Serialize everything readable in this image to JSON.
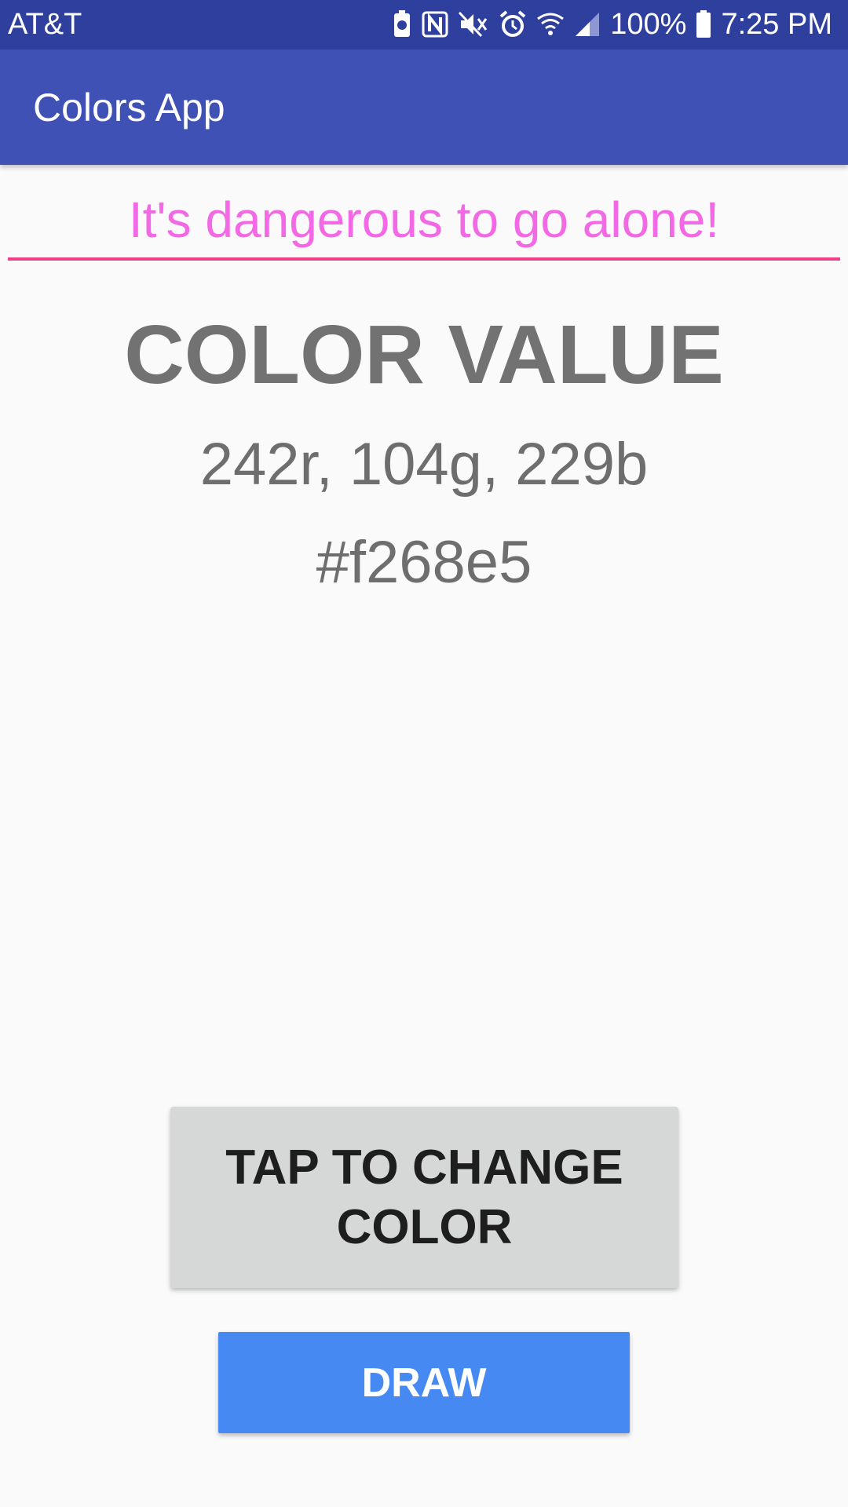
{
  "status_bar": {
    "carrier": "AT&T",
    "battery_percent": "100%",
    "time": "7:25 PM",
    "icons": [
      "battery-saver-icon",
      "nfc-icon",
      "mute-icon",
      "alarm-icon",
      "wifi-icon",
      "signal-icon",
      "battery-icon"
    ]
  },
  "app_bar": {
    "title": "Colors App",
    "color": "#3f51b5"
  },
  "text_input": {
    "value": "It's dangerous to go alone!",
    "text_color": "#f268e5",
    "underline_color": "#f03f8a"
  },
  "color_display": {
    "heading": "COLOR VALUE",
    "rgb": "242r, 104g, 229b",
    "hex": "#f268e5"
  },
  "buttons": {
    "change_color_label": "TAP TO CHANGE COLOR",
    "draw_label": "DRAW",
    "draw_color": "#4689f2"
  }
}
